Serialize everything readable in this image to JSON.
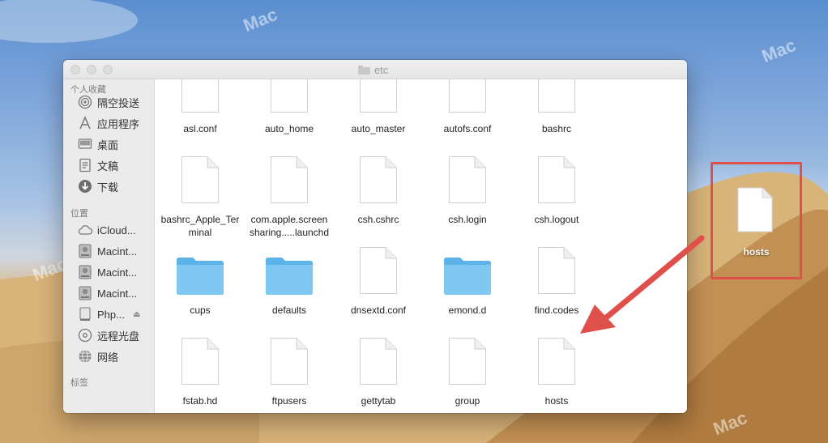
{
  "window": {
    "title": "etc"
  },
  "sidebar": {
    "favorites_header": "个人收藏",
    "favorites": [
      {
        "label": "隔空投送",
        "icon": "airdrop-icon"
      },
      {
        "label": "应用程序",
        "icon": "applications-icon"
      },
      {
        "label": "桌面",
        "icon": "desktop-icon"
      },
      {
        "label": "文稿",
        "icon": "documents-icon"
      },
      {
        "label": "下载",
        "icon": "downloads-icon"
      }
    ],
    "locations_header": "位置",
    "locations": [
      {
        "label": "iCloud...",
        "icon": "icloud-icon"
      },
      {
        "label": "Macint...",
        "icon": "hard-drive-icon"
      },
      {
        "label": "Macint...",
        "icon": "hard-drive-icon"
      },
      {
        "label": "Macint...",
        "icon": "hard-drive-icon"
      },
      {
        "label": "Php...",
        "icon": "external-drive-icon"
      },
      {
        "label": "远程光盘",
        "icon": "remote-disc-icon"
      },
      {
        "label": "网络",
        "icon": "network-icon"
      }
    ],
    "tags_header": "标签"
  },
  "files": [
    {
      "name": "asl.conf",
      "kind": "doc"
    },
    {
      "name": "auto_home",
      "kind": "doc"
    },
    {
      "name": "auto_master",
      "kind": "doc"
    },
    {
      "name": "autofs.conf",
      "kind": "doc"
    },
    {
      "name": "bashrc",
      "kind": "doc"
    },
    {
      "name": "bashrc_Apple_Terminal",
      "line1": "bashrc_Apple_Ter",
      "line2": "minal",
      "kind": "doc"
    },
    {
      "name": "com.apple.screensharing.....launchd",
      "line1": "com.apple.screen",
      "line2": "sharing.....launchd",
      "kind": "doc"
    },
    {
      "name": "csh.cshrc",
      "kind": "doc"
    },
    {
      "name": "csh.login",
      "kind": "doc"
    },
    {
      "name": "csh.logout",
      "kind": "doc"
    },
    {
      "name": "cups",
      "kind": "folder"
    },
    {
      "name": "defaults",
      "kind": "folder"
    },
    {
      "name": "dnsextd.conf",
      "kind": "doc"
    },
    {
      "name": "emond.d",
      "kind": "folder"
    },
    {
      "name": "find.codes",
      "kind": "doc"
    },
    {
      "name": "fstab.hd",
      "kind": "doc"
    },
    {
      "name": "ftpusers",
      "kind": "doc"
    },
    {
      "name": "gettytab",
      "kind": "doc"
    },
    {
      "name": "group",
      "kind": "doc"
    },
    {
      "name": "hosts",
      "kind": "doc"
    }
  ],
  "desktop_file": {
    "name": "hosts",
    "icon": "document-icon"
  },
  "annotation": {
    "box_color": "#e0504a",
    "arrow_color": "#e0504a"
  },
  "watermark": "Mac"
}
